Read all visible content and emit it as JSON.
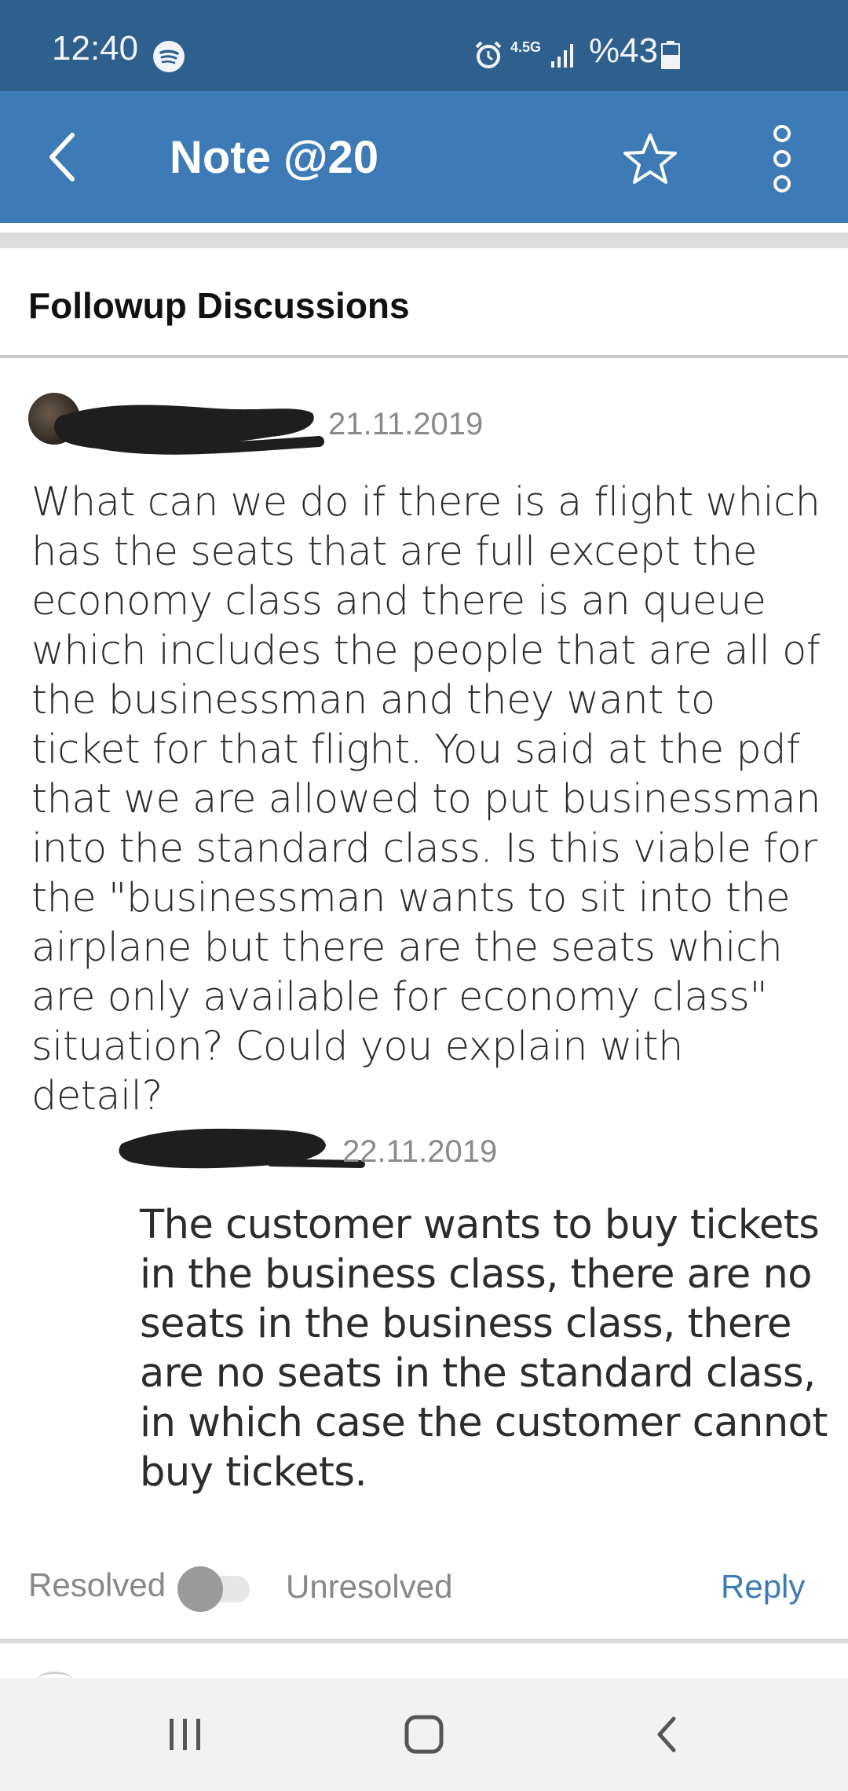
{
  "status_bar": {
    "time": "12:40",
    "network_label": "4.5G",
    "battery": "%43",
    "icons": [
      "spotify-icon",
      "alarm-icon",
      "signal-icon",
      "battery-icon"
    ]
  },
  "app_bar": {
    "title": "Note @20",
    "icons": [
      "back-arrow-icon",
      "star-icon",
      "more-vertical-icon"
    ]
  },
  "section": {
    "title": "Followup Discussions"
  },
  "post": {
    "date": "21.11.2019",
    "body": "What can we do if there is a flight which has the seats that are full except the economy class and there is an queue which includes the people that are all of the businessman and they want to ticket for that flight. You said at the pdf that we are allowed to put businessman into the standard class. Is this viable for the \"businessman wants to sit into the airplane but there are the seats which are only available for economy class\" situation? Could you explain with detail?"
  },
  "reply": {
    "date": "22.11.2019",
    "body": "The customer wants to buy tickets in the business class, there are no seats in the business class, there are no seats in the standard class, in which case the customer cannot buy tickets."
  },
  "footer": {
    "resolved_label": "Resolved",
    "unresolved_label": "Unresolved",
    "reply_label": "Reply",
    "resolved": false
  },
  "colors": {
    "status_bar": "#2f5f8d",
    "app_bar": "#3e7bb6",
    "accent": "#3e7bb6"
  }
}
